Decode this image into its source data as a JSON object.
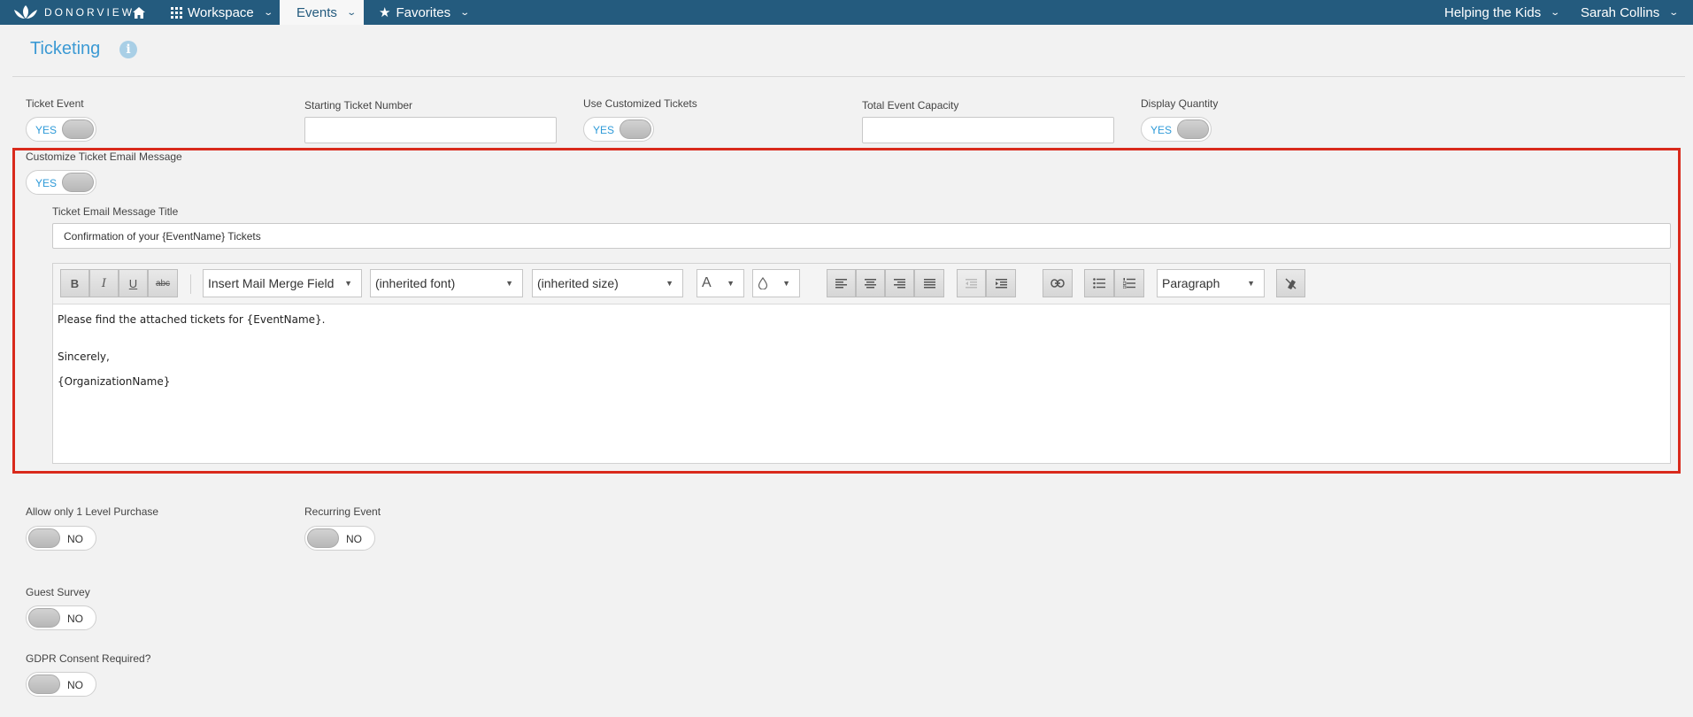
{
  "nav": {
    "logo_text": "DONORVIEW",
    "workspace": "Workspace",
    "events": "Events",
    "favorites": "Favorites",
    "org": "Helping the Kids",
    "user": "Sarah Collins"
  },
  "page": {
    "title": "Ticketing"
  },
  "fields": {
    "ticket_event": {
      "label": "Ticket Event",
      "state": "YES"
    },
    "starting_ticket_number": {
      "label": "Starting Ticket Number",
      "value": ""
    },
    "use_customized_tickets": {
      "label": "Use Customized Tickets",
      "state": "YES"
    },
    "total_event_capacity": {
      "label": "Total Event Capacity",
      "value": ""
    },
    "display_quantity": {
      "label": "Display Quantity",
      "state": "YES"
    },
    "customize_email": {
      "label": "Customize Ticket Email Message",
      "state": "YES"
    },
    "email_title": {
      "label": "Ticket Email Message Title",
      "value": "Confirmation of your {EventName} Tickets"
    },
    "allow_one_level": {
      "label": "Allow only 1 Level Purchase",
      "state": "NO"
    },
    "recurring_event": {
      "label": "Recurring Event",
      "state": "NO"
    },
    "guest_survey": {
      "label": "Guest Survey",
      "state": "NO"
    },
    "gdpr": {
      "label": "GDPR Consent Required?",
      "state": "NO"
    }
  },
  "editor": {
    "bold": "B",
    "italic": "I",
    "underline": "U",
    "strike": "abc",
    "merge_field": "Insert Mail Merge Field",
    "font": "(inherited font)",
    "size": "(inherited size)",
    "font_color": "A",
    "block_format": "Paragraph",
    "body": {
      "line1": "Please find the attached tickets for {EventName}.",
      "line2": "Sincerely,",
      "line3": "{OrganizationName}"
    }
  },
  "colors": {
    "nav_bg": "#245b7e",
    "accent": "#3c9ad4",
    "highlight": "#d92a1c"
  }
}
